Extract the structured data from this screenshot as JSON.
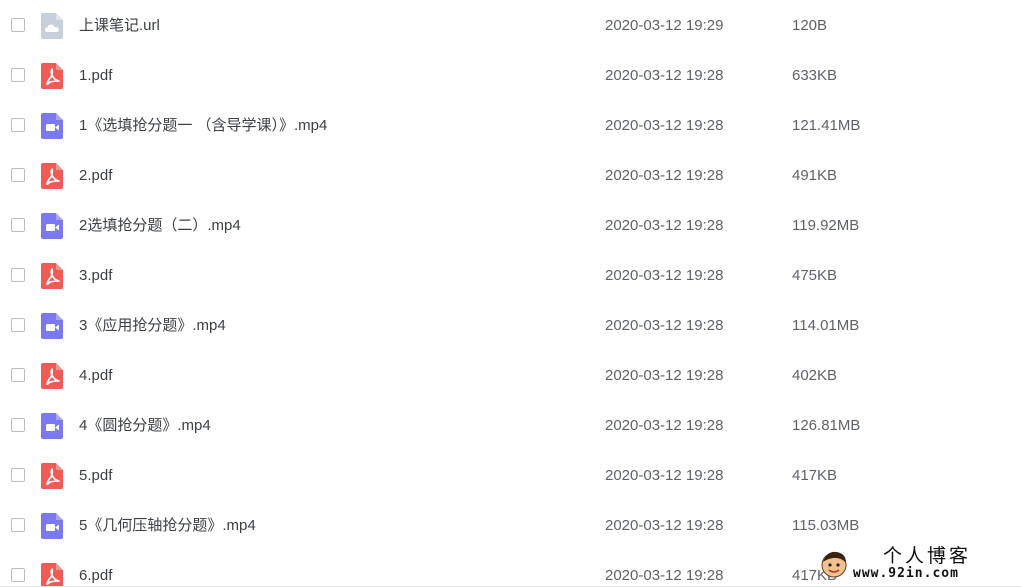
{
  "files": [
    {
      "name": "上课笔记.url",
      "type": "url",
      "icon": "cloud-link-icon",
      "date": "2020-03-12 19:29",
      "size": "120B"
    },
    {
      "name": "1.pdf",
      "type": "pdf",
      "icon": "pdf-icon",
      "date": "2020-03-12 19:28",
      "size": "633KB"
    },
    {
      "name": "1《选填抢分题一 （含导学课）》.mp4",
      "type": "video",
      "icon": "video-icon",
      "date": "2020-03-12 19:28",
      "size": "121.41MB"
    },
    {
      "name": "2.pdf",
      "type": "pdf",
      "icon": "pdf-icon",
      "date": "2020-03-12 19:28",
      "size": "491KB"
    },
    {
      "name": "2选填抢分题（二）.mp4",
      "type": "video",
      "icon": "video-icon",
      "date": "2020-03-12 19:28",
      "size": "119.92MB"
    },
    {
      "name": "3.pdf",
      "type": "pdf",
      "icon": "pdf-icon",
      "date": "2020-03-12 19:28",
      "size": "475KB"
    },
    {
      "name": "3《应用抢分题》.mp4",
      "type": "video",
      "icon": "video-icon",
      "date": "2020-03-12 19:28",
      "size": "114.01MB"
    },
    {
      "name": "4.pdf",
      "type": "pdf",
      "icon": "pdf-icon",
      "date": "2020-03-12 19:28",
      "size": "402KB"
    },
    {
      "name": "4《圆抢分题》.mp4",
      "type": "video",
      "icon": "video-icon",
      "date": "2020-03-12 19:28",
      "size": "126.81MB"
    },
    {
      "name": "5.pdf",
      "type": "pdf",
      "icon": "pdf-icon",
      "date": "2020-03-12 19:28",
      "size": "417KB"
    },
    {
      "name": "5《几何压轴抢分题》.mp4",
      "type": "video",
      "icon": "video-icon",
      "date": "2020-03-12 19:28",
      "size": "115.03MB"
    },
    {
      "name": "6.pdf",
      "type": "pdf",
      "icon": "pdf-icon",
      "date": "2020-03-12 19:28",
      "size": "417KB"
    }
  ],
  "colors": {
    "pdf": "#f25a55",
    "video": "#7b79f0",
    "url": "#c5d0dc"
  },
  "watermark": {
    "title": "个人博客",
    "url": "www.92in.com"
  }
}
